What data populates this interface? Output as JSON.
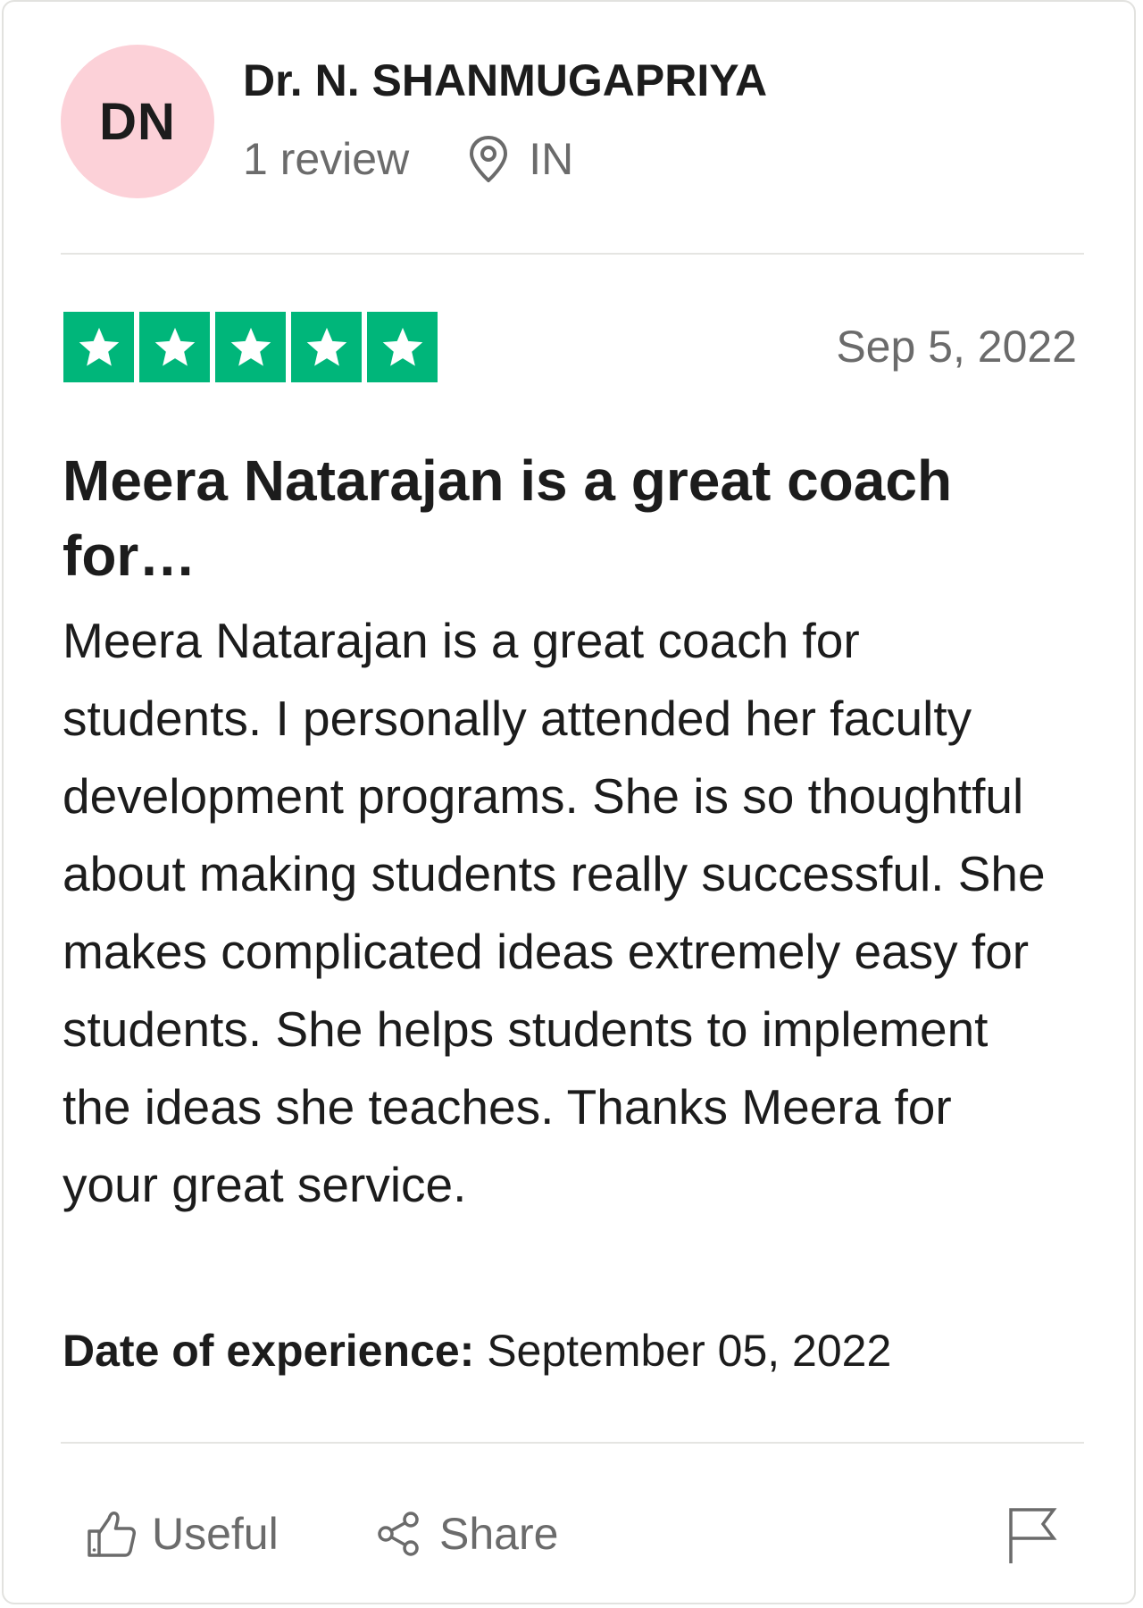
{
  "reviewer": {
    "initials": "DN",
    "name": "Dr. N. SHANMUGAPRIYA",
    "review_count": "1 review",
    "location": "IN",
    "avatar_color": "#fcd1d8"
  },
  "review": {
    "rating": 5,
    "max_rating": 5,
    "star_color": "#00b67a",
    "date": "Sep 5, 2022",
    "title": "Meera Natarajan is a great coach for…",
    "body": "Meera Natarajan is a great coach for students. I personally attended her faculty development programs. She is so thoughtful about making students really successful. She makes complicated ideas extremely easy for students. She helps students to implement the ideas she teaches. Thanks Meera for your great service.",
    "experience_label": "Date of experience:",
    "experience_date": "September 05, 2022"
  },
  "actions": {
    "useful_label": "Useful",
    "share_label": "Share",
    "useful_icon": "thumbs-up-icon",
    "share_icon": "share-icon",
    "flag_icon": "flag-icon"
  }
}
